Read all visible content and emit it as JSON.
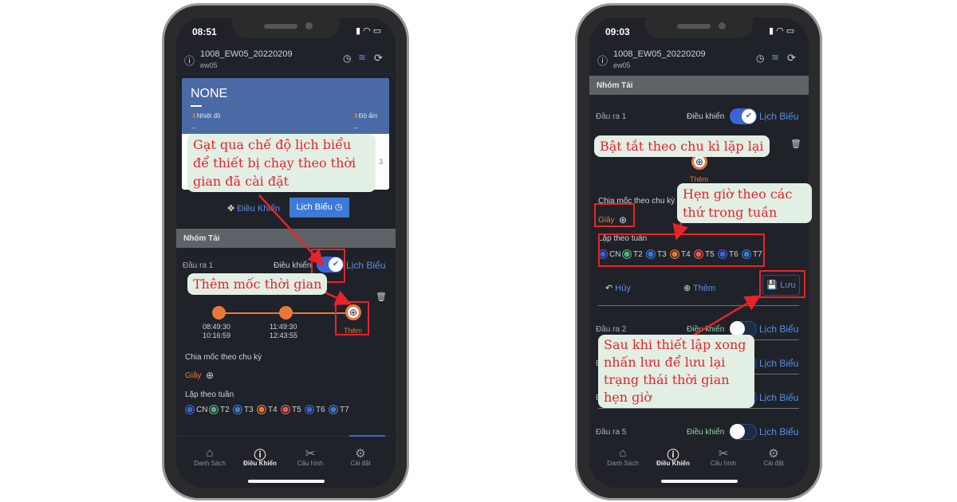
{
  "colors": {
    "accent": "#3d63d8",
    "orange": "#e8783a",
    "annotation": "#e8232a",
    "callout_bg": "#e2efe4"
  },
  "common": {
    "device_title": "1008_EW05_20220209",
    "device_sub": "ew05",
    "group": "Nhóm Tải",
    "control": "Điều khiển",
    "schedule": "Lịch Biểu",
    "add": "Thêm",
    "cycle_label": "Chia mốc theo chu kỳ",
    "unit": "Giây",
    "weekly_label": "Lặp theo tuần",
    "days": [
      {
        "label": "CN",
        "color": "#3d63d8"
      },
      {
        "label": "T2",
        "color": "#4fb07e"
      },
      {
        "label": "T3",
        "color": "#3a7ad6"
      },
      {
        "label": "T4",
        "color": "#e8783a"
      },
      {
        "label": "T5",
        "color": "#e85a5a"
      },
      {
        "label": "T6",
        "color": "#3d63d8"
      },
      {
        "label": "T7",
        "color": "#3a7ad6"
      }
    ],
    "nav": [
      {
        "label": "Danh Sách",
        "icon": "home-icon"
      },
      {
        "label": "Điều Khiển",
        "icon": "info-icon",
        "active": true
      },
      {
        "label": "Cấu hình",
        "icon": "wrench-icon"
      },
      {
        "label": "Cài đặt",
        "icon": "gear-icon"
      }
    ]
  },
  "phone1": {
    "time": "08:51",
    "card_title": "NONE",
    "temp_label": "Nhiệt độ",
    "hum_label": "Độ ẩm",
    "temp_value": "--",
    "hum_value": "--",
    "card_side": "3",
    "mode_control": "Điều Khiển",
    "mode_schedule": "Lịch Biểu",
    "output": "Đầu ra 1",
    "output_toggle_on": true,
    "timeline": [
      {
        "start": "08:49:30",
        "end": "10:16:59"
      },
      {
        "start": "11:49:30",
        "end": "12:43:55"
      }
    ],
    "callouts": [
      "Gạt qua chế độ lịch biểu để thiết bị chạy theo thời gian đã cài đặt",
      "Thêm mốc thời gian"
    ]
  },
  "phone2": {
    "time": "09:03",
    "outputs": [
      {
        "label": "Đầu ra 1",
        "on": true
      },
      {
        "label": "Đầu ra 2",
        "on": false
      },
      {
        "label": "Đầu ra 3",
        "on": false
      },
      {
        "label": "Đầu ra 4",
        "on": false
      },
      {
        "label": "Đầu ra 5",
        "on": false
      }
    ],
    "cancel": "Hủy",
    "add": "Thêm",
    "save": "Lưu",
    "callouts": [
      "Bật tắt theo chu kì lặp lại",
      "Hẹn giờ theo các thứ trong tuần",
      "Sau khi thiết lập xong nhấn lưu để lưu lại trạng thái thời gian hẹn giờ"
    ]
  }
}
